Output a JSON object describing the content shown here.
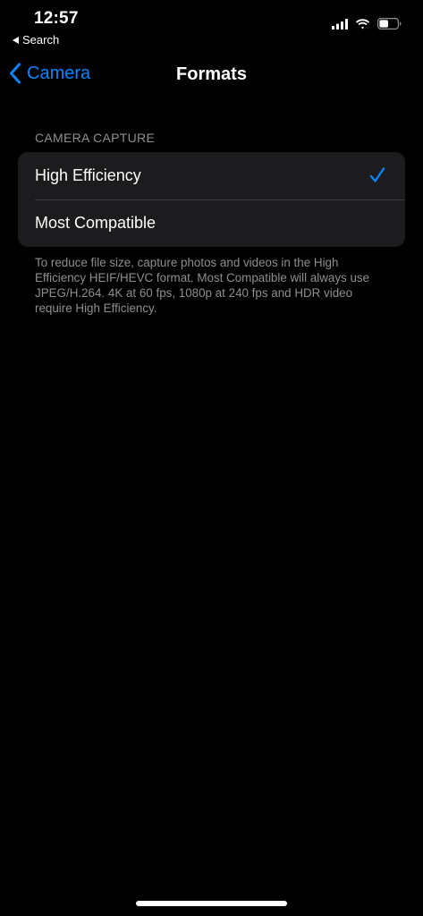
{
  "status_bar": {
    "time": "12:57",
    "back_app_label": "Search",
    "battery_level": 0.5
  },
  "nav": {
    "back_label": "Camera",
    "title": "Formats"
  },
  "section": {
    "header": "CAMERA CAPTURE",
    "options": [
      {
        "label": "High Efficiency",
        "selected": true
      },
      {
        "label": "Most Compatible",
        "selected": false
      }
    ],
    "footer": "To reduce file size, capture photos and videos in the High Efficiency HEIF/HEVC format. Most Compatible will always use JPEG/H.264. 4K at 60 fps, 1080p at 240 fps and HDR video require High Efficiency."
  },
  "colors": {
    "accent": "#0a84ff",
    "background": "#000000",
    "group_background": "#1c1c1e",
    "secondary_text": "#8e8e93"
  }
}
